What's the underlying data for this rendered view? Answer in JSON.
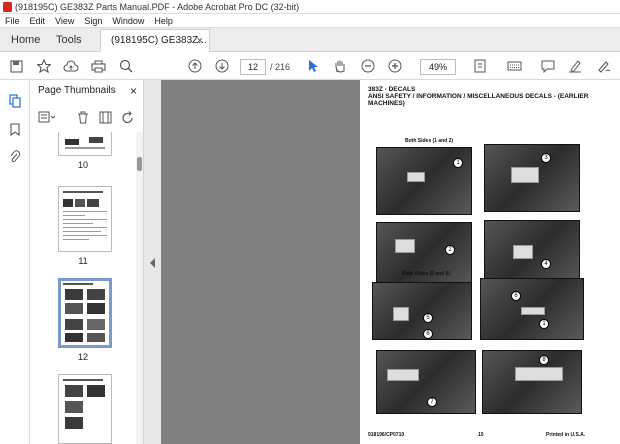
{
  "window": {
    "title": "(918195C) GE383Z Parts Manual.PDF - Adobe Acrobat Pro DC (32-bit)"
  },
  "menu": [
    "File",
    "Edit",
    "View",
    "Sign",
    "Window",
    "Help"
  ],
  "tabs": {
    "home": "Home",
    "tools": "Tools",
    "document": "(918195C) GE383Z...",
    "close": "×"
  },
  "toolbar": {
    "page_current": "12",
    "page_total": "/ 216",
    "zoom": "49%"
  },
  "panel": {
    "title": "Page Thumbnails",
    "close": "×",
    "thumbs": [
      {
        "label": "10"
      },
      {
        "label": "11"
      },
      {
        "label": "12"
      }
    ]
  },
  "page": {
    "title_line1": "383Z - DECALS",
    "title_line2": "ANSI SAFETY / INFORMATION / MISCELLANEOUS DECALS - (EARLIER",
    "title_line3": "MACHINES)",
    "caption_top": "Both Sides (1 and 2)",
    "caption_mid": "Both Sides (5 and 6)",
    "callouts": [
      "1",
      "3",
      "2",
      "4",
      "5",
      "6",
      "6",
      "1",
      "7",
      "8"
    ],
    "footer_left": "918196/CP0710",
    "footer_mid": "10",
    "footer_right": "Printed in U.S.A."
  }
}
